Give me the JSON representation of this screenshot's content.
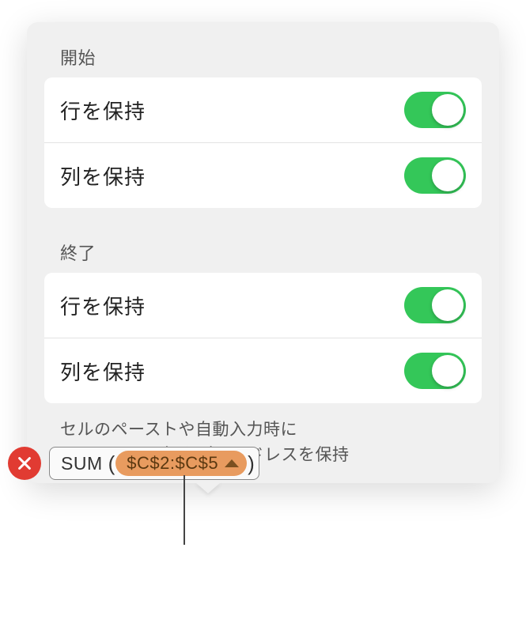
{
  "popover": {
    "start": {
      "header": "開始",
      "rows": [
        {
          "label": "行を保持",
          "on": true
        },
        {
          "label": "列を保持",
          "on": true
        }
      ]
    },
    "end": {
      "header": "終了",
      "rows": [
        {
          "label": "行を保持",
          "on": true
        },
        {
          "label": "列を保持",
          "on": true
        }
      ]
    },
    "help_line1": "セルのペーストや自動入力時に",
    "help_line2": "オリジナルの行や列のアドレスを保持"
  },
  "formula": {
    "function": "SUM",
    "open_paren": "(",
    "range": "$C$2:$C$5",
    "close_paren": ")"
  }
}
